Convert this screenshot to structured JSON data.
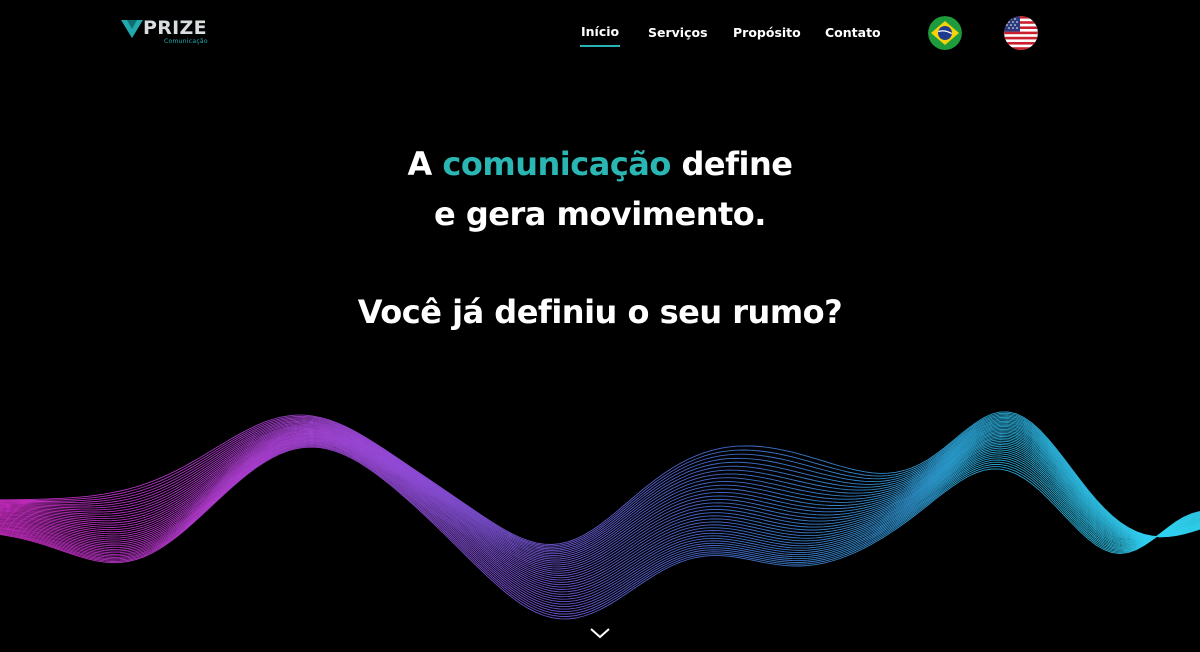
{
  "brand": {
    "name": "PRIZE",
    "tagline": "Comunicação",
    "accent_color": "#2ab7b4"
  },
  "nav": {
    "items": [
      {
        "label": "Início",
        "active": true
      },
      {
        "label": "Serviços",
        "active": false
      },
      {
        "label": "Propósito",
        "active": false
      },
      {
        "label": "Contato",
        "active": false
      }
    ]
  },
  "languages": [
    {
      "icon": "brazil-flag-icon",
      "code": "pt-BR"
    },
    {
      "icon": "usa-flag-icon",
      "code": "en-US"
    }
  ],
  "hero": {
    "line1_before": "A",
    "line1_highlight": "comunicação",
    "line1_after": "define",
    "line2": "e gera movimento.",
    "line3": "Você já definiu o seu rumo?"
  },
  "scroll": {
    "icon": "chevron-down-icon"
  },
  "colors": {
    "background": "#000000",
    "wave_start": "#e030d8",
    "wave_mid": "#8a5cf0",
    "wave_blue": "#4f7be8",
    "wave_end": "#2fd4f0"
  }
}
